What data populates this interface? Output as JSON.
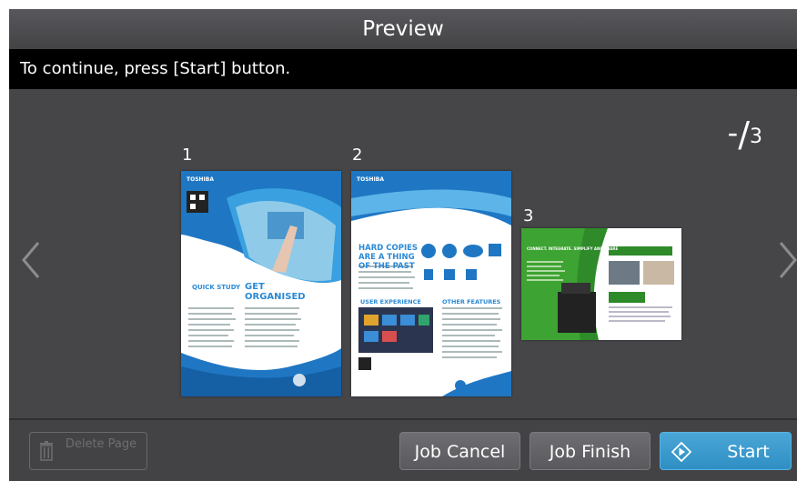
{
  "window": {
    "title": "Preview"
  },
  "message": "To continue, press [Start] button.",
  "page_counter": {
    "current": "-",
    "total": "3"
  },
  "pages": [
    {
      "number": "1"
    },
    {
      "number": "2"
    },
    {
      "number": "3"
    }
  ],
  "page1": {
    "brand": "TOSHIBA",
    "heading_left": "QUICK STUDY",
    "heading_right_1": "GET",
    "heading_right_2": "ORGANISED"
  },
  "page2": {
    "brand": "TOSHIBA",
    "headline_1": "HARD COPIES",
    "headline_2": "ARE A THING",
    "headline_3": "OF THE PAST",
    "section_left": "USER EXPERIENCE",
    "section_right": "OTHER FEATURES"
  },
  "page3": {
    "heading": "CONNECT. INTEGRATE. SIMPLIFY AND SHARE"
  },
  "buttons": {
    "delete_page": "Delete Page",
    "job_cancel": "Job Cancel",
    "job_finish": "Job Finish",
    "start": "Start"
  },
  "colors": {
    "accent": "#2f8fc4",
    "title_bar": "#4e4e52",
    "message_bar": "#000000",
    "content_bg": "#464649"
  },
  "icons": {
    "nav_left": "chevron-left-icon",
    "nav_right": "chevron-right-icon",
    "delete": "trash-icon",
    "start": "diamond-start-icon"
  }
}
